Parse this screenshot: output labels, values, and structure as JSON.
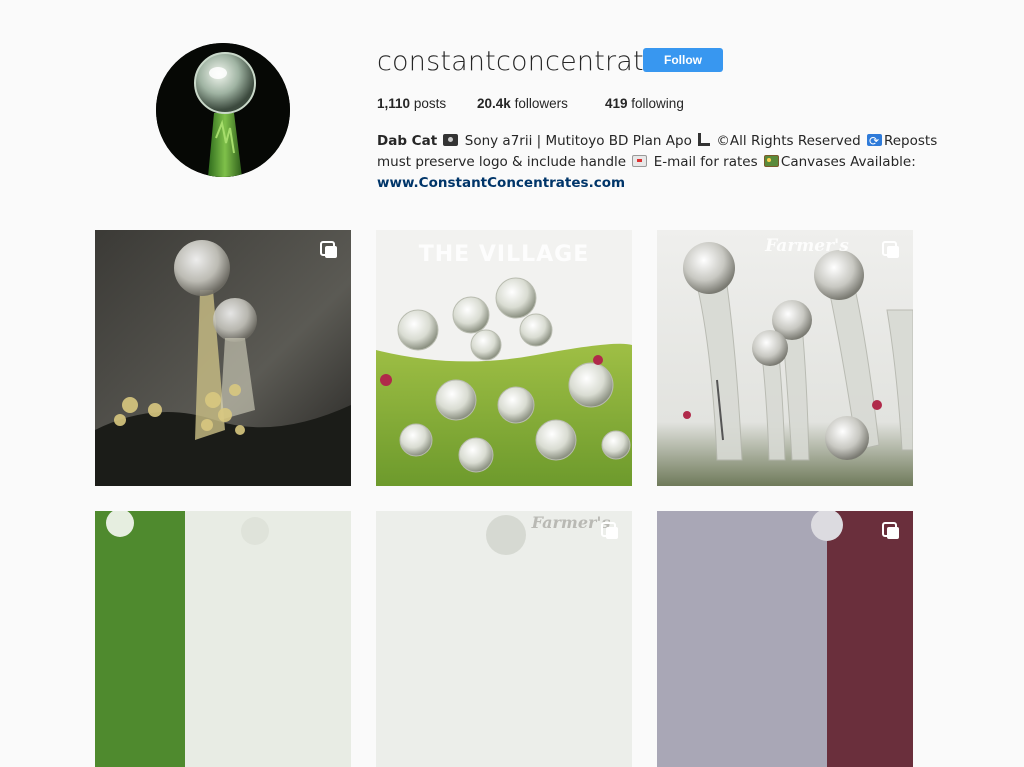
{
  "profile": {
    "username": "constantconcentrates",
    "follow_label": "Follow",
    "stats": {
      "posts_count": "1,110",
      "posts_label": "posts",
      "followers_count": "20.4k",
      "followers_label": "followers",
      "following_count": "419",
      "following_label": "following"
    },
    "bio": {
      "name": "Dab Cat",
      "line1_text": "Sony a7rii | Mutitoyo BD Plan Apo",
      "line1_rights": "©All Rights Reserved",
      "line1_reposts": "Reposts",
      "line2_text": "must preserve logo & include handle",
      "line2_email": "E-mail for rates",
      "line2_canvas": "Canvases Available:",
      "link": "www.ConstantConcentrates.com"
    }
  },
  "posts": [
    {
      "watermark": "",
      "multi": true
    },
    {
      "watermark": "THE VILLAGE",
      "multi": false
    },
    {
      "watermark": "Farmer's",
      "multi": true
    },
    {
      "watermark": "",
      "multi": false
    },
    {
      "watermark": "Farmer's",
      "multi": true
    },
    {
      "watermark": "",
      "multi": true
    }
  ],
  "icons": {
    "multi_post": "stacked-squares-icon",
    "camera": "camera-icon",
    "microscope": "microscope-icon",
    "repost": "repost-icon",
    "email": "envelope-icon",
    "canvas": "framed-picture-icon"
  },
  "colors": {
    "follow_button": "#3897f0",
    "link": "#003569",
    "background": "#fafafa"
  }
}
